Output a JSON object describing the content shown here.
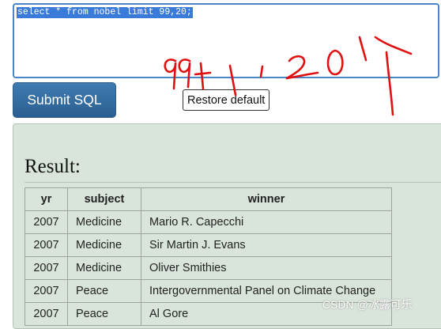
{
  "editor": {
    "query": "select * from nobel limit 99,20;"
  },
  "submit": {
    "label": "Submit SQL"
  },
  "tooltip": {
    "text": "Restore default"
  },
  "result": {
    "title": "Result:",
    "columns": [
      "yr",
      "subject",
      "winner"
    ],
    "rows": [
      [
        "2007",
        "Medicine",
        "Mario R. Capecchi"
      ],
      [
        "2007",
        "Medicine",
        "Sir Martin J. Evans"
      ],
      [
        "2007",
        "Medicine",
        "Oliver Smithies"
      ],
      [
        "2007",
        "Peace",
        "Intergovernmental Panel on Climate Change"
      ],
      [
        "2007",
        "Peace",
        "Al Gore"
      ]
    ]
  },
  "handwriting": {
    "text": "99+1,20个",
    "color": "#e01010"
  },
  "watermark": {
    "text": "CSDN @冰露可乐"
  },
  "colors": {
    "button": "#2b5f91",
    "editor_border": "#4a86c8",
    "panel": "#d9e5da"
  }
}
